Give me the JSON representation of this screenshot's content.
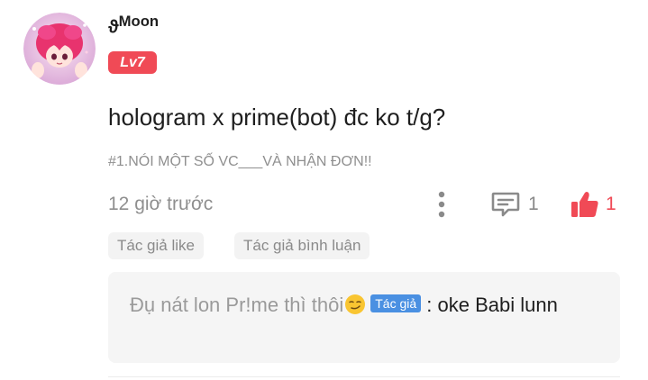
{
  "post": {
    "author": {
      "prefix_glyph": "ϑ",
      "name": "Moon",
      "level": "Lv7",
      "avatar_icon": "anime-avatar-icon"
    },
    "title": "hologram x prime(bot) đc ko t/g?",
    "topic": "#1.NÓI MỘT SỐ VC___VÀ NHẬN ĐƠN!!",
    "timestamp": "12 giờ trước",
    "comment_count": "1",
    "like_count": "1"
  },
  "chips": {
    "author_like": "Tác giả like",
    "author_comment": "Tác giả bình luận"
  },
  "comment_preview": {
    "quoted_text": "Đụ nát lon Pr!me thì thôi",
    "author_badge": "Tác giả",
    "separator": ":",
    "reply_text": "oke Babi lunn"
  },
  "colors": {
    "accent_red": "#f04a56",
    "badge_blue": "#4a90e2",
    "muted_text": "#8f8f8f",
    "chip_bg": "#f3f3f3"
  }
}
